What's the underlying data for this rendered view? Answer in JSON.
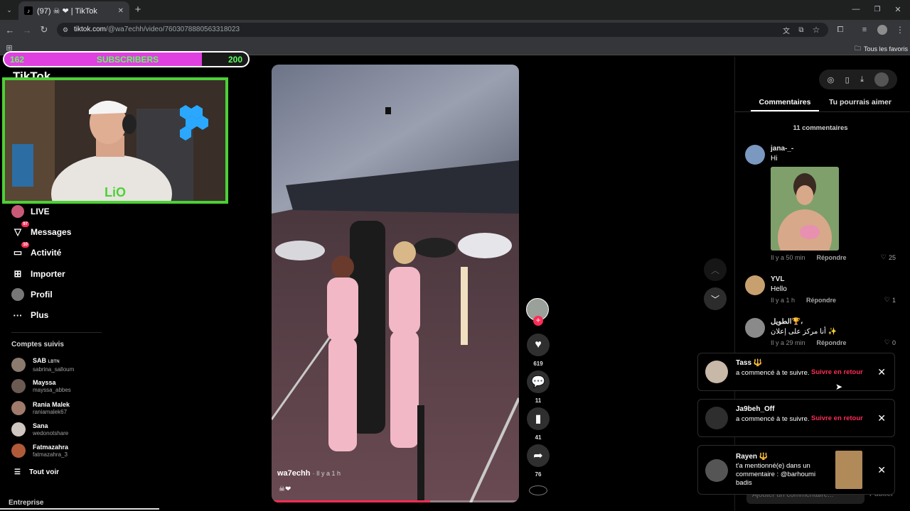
{
  "browser": {
    "tab_title": "(97) ☠ ❤ | TikTok",
    "url_host": "tiktok.com",
    "url_path": "/@wa7echh/video/7603078880563318023",
    "bookmarks_label": "Tous les favoris"
  },
  "overlay": {
    "sub_current": "162",
    "sub_label": "SUBSCRIBERS",
    "sub_goal": "200",
    "sub_progress": 0.81,
    "cam_tag": "LiO",
    "logo_text": "TikTok"
  },
  "sidebar": {
    "items": [
      {
        "label": "LIVE",
        "icon": "live-icon"
      },
      {
        "label": "Messages",
        "icon": "messages-icon",
        "badge": "97"
      },
      {
        "label": "Activité",
        "icon": "activity-icon",
        "badge": "10"
      },
      {
        "label": "Importer",
        "icon": "upload-icon"
      },
      {
        "label": "Profil",
        "icon": "profile-icon"
      },
      {
        "label": "Plus",
        "icon": "more-icon"
      }
    ],
    "following_title": "Comptes suivis",
    "following": [
      {
        "name": "SAB",
        "tag": "LBTN",
        "username": "sabrina_salloum"
      },
      {
        "name": "Mayssa",
        "username": "mayssa_abbes"
      },
      {
        "name": "Rania Malek",
        "username": "raniamalek67"
      },
      {
        "name": "Sana",
        "username": "wedonotshare"
      },
      {
        "name": "Fatmazahra",
        "username": "fatmazahra_3"
      }
    ],
    "see_all": "Tout voir",
    "footer": "Entreprise"
  },
  "video": {
    "author": "wa7echh",
    "time": "· Il y a 1 h",
    "caption": "☠❤",
    "progress": 0.64,
    "likes": "619",
    "comments": "11",
    "saves": "41",
    "shares": "76"
  },
  "panel": {
    "tab_comments": "Commentaires",
    "tab_suggested": "Tu pourrais aimer",
    "count_label": "11 commentaires",
    "reply_label": "Répondre",
    "comments": [
      {
        "name": "jana-_-",
        "text": "Hi",
        "time": "Il y a 50 min",
        "likes": "25"
      },
      {
        "name": "YVL",
        "text": "Hello",
        "time": "Il y a 1 h",
        "likes": "1"
      },
      {
        "name": "الطويل🏆،",
        "text": "أنا مركز على إعلان ✨",
        "time": "Il y a 29 min",
        "likes": "0"
      }
    ],
    "add_comment_placeholder": "Ajouter un commentaire...",
    "post_label": "Publier"
  },
  "notifications": [
    {
      "name": "Tass 🔱",
      "message": "a commencé à te suivre.",
      "action": "Suivre en retour"
    },
    {
      "name": "Ja9beh_Off",
      "message": "a commencé à te suivre.",
      "action": "Suivre en retour"
    },
    {
      "name": "Rayen 🔱",
      "message": "t'a mentionné(e) dans un commentaire : @barhoumi badis"
    }
  ],
  "colors": {
    "tiktok_red": "#fe2c55",
    "overlay_pink": "#e040e0",
    "overlay_green": "#4cd137"
  }
}
